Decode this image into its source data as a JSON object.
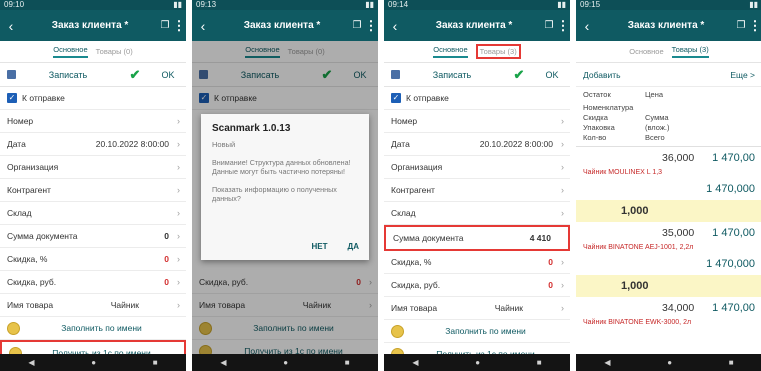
{
  "screens": [
    {
      "time": "09:10",
      "title": "Заказ клиента *",
      "tabs": [
        "Основное",
        "Товары (0)"
      ],
      "save": "Записать",
      "ok": "OK",
      "to_send": "К отправке",
      "rows": [
        {
          "label": "Номер",
          "value": ""
        },
        {
          "label": "Дата",
          "value": "20.10.2022 8:00:00"
        },
        {
          "label": "Организация",
          "value": ""
        },
        {
          "label": "Контрагент",
          "value": ""
        },
        {
          "label": "Склад",
          "value": ""
        },
        {
          "label": "Сумма документа",
          "value": "0"
        },
        {
          "label": "Скидка, %",
          "value": "0"
        },
        {
          "label": "Скидка, руб.",
          "value": "0"
        },
        {
          "label": "Имя товара",
          "value": "Чайник"
        }
      ],
      "fill_by_name": "Заполнить по имени",
      "get_from_1c": "Получить из 1с по имени"
    },
    {
      "time": "09:13",
      "title": "Заказ клиента *",
      "tabs": [
        "Основное",
        "Товары (0)"
      ],
      "save": "Записать",
      "ok": "OK",
      "to_send": "К отправке",
      "rows_after": [
        {
          "label": "Скидка, руб.",
          "value": "0"
        },
        {
          "label": "Имя товара",
          "value": "Чайник"
        }
      ],
      "fill_by_name": "Заполнить по имени",
      "get_from_1c": "Получить из 1с по имени",
      "dialog": {
        "title": "Scanmark 1.0.13",
        "subtitle": "Новый",
        "message1": "Внимание! Структура данных обновлена! Данные могут быть частично потеряны!",
        "message2": "Показать информацию о полученных данных?",
        "no": "НЕТ",
        "yes": "ДА"
      }
    },
    {
      "time": "09:14",
      "title": "Заказ клиента *",
      "tabs": [
        "Основное",
        "Товары (3)"
      ],
      "save": "Записать",
      "ok": "OK",
      "to_send": "К отправке",
      "rows": [
        {
          "label": "Номер",
          "value": ""
        },
        {
          "label": "Дата",
          "value": "20.10.2022 8:00:00"
        },
        {
          "label": "Организация",
          "value": ""
        },
        {
          "label": "Контрагент",
          "value": ""
        },
        {
          "label": "Склад",
          "value": ""
        },
        {
          "label": "Сумма документа",
          "value": "4 410"
        },
        {
          "label": "Скидка, %",
          "value": "0"
        },
        {
          "label": "Скидка, руб.",
          "value": "0"
        },
        {
          "label": "Имя товара",
          "value": "Чайник"
        }
      ],
      "fill_by_name": "Заполнить по имени",
      "get_from_1c": "Получить из 1с по имени"
    },
    {
      "time": "09:15",
      "title": "Заказ клиента *",
      "tabs": [
        "Основное",
        "Товары (3)"
      ],
      "add": "Добавить",
      "more": "Еще >",
      "header": {
        "line1": [
          "Остаток",
          "Цена"
        ],
        "line2": [
          "Номенклатура",
          ""
        ],
        "line3": [
          "Скидка",
          "Сумма"
        ],
        "line4": [
          "Упаковка",
          "(влож.)"
        ],
        "line5": [
          "Кол-во",
          "Всего"
        ]
      },
      "items": [
        {
          "price": "36,000",
          "sum": "1 470,00",
          "name": "Чайник MOULINEX L 1,3",
          "total": "1 470,000",
          "qty": "1,000"
        },
        {
          "price": "35,000",
          "sum": "1 470,00",
          "name": "Чайник BINATONE AEJ-1001, 2,2л",
          "total": "1 470,000",
          "qty": "1,000"
        },
        {
          "price": "34,000",
          "sum": "1 470,00",
          "name": "Чайник BINATONE EWK-3000, 2л"
        }
      ]
    }
  ],
  "nav": [
    "◀",
    "●",
    "■"
  ]
}
